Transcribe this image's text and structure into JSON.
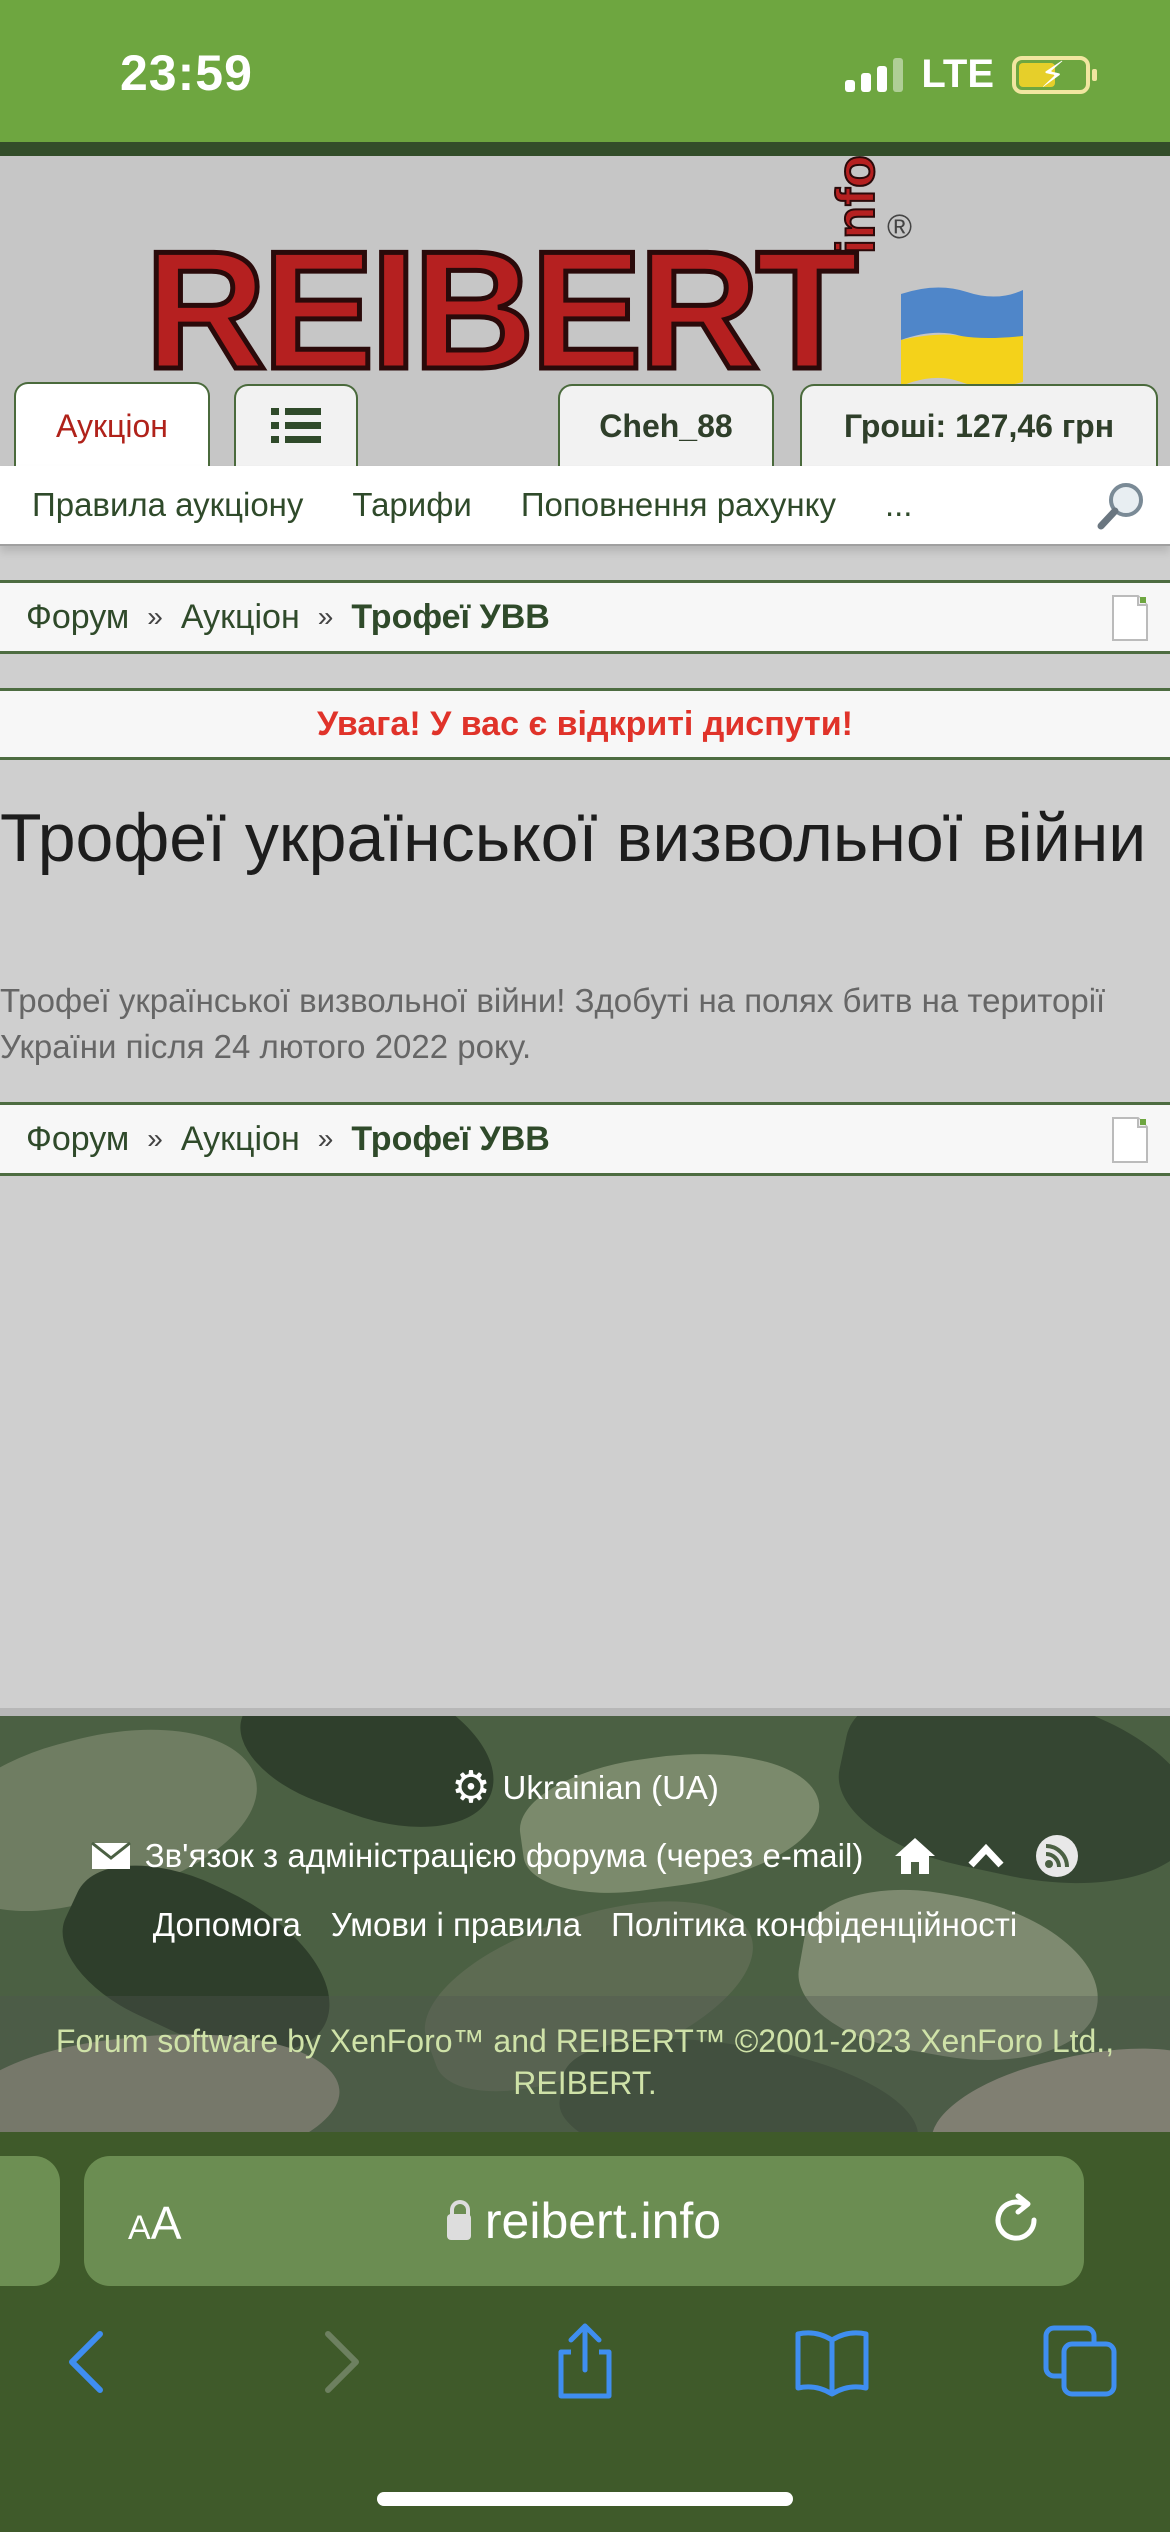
{
  "status": {
    "time": "23:59",
    "network": "LTE"
  },
  "logo": {
    "main": "REIBERT",
    "sub": "info",
    "reg": "®"
  },
  "tabs": {
    "auction": "Аукціон",
    "user": "Cheh_88",
    "money": "Гроші: 127,46 грн"
  },
  "nav": {
    "items": [
      "Правила аукціону",
      "Тарифи",
      "Поповнення рахунку",
      "..."
    ]
  },
  "breadcrumb": {
    "forum": "Форум",
    "auction": "Аукціон",
    "current": "Трофеї УВВ",
    "sep": "»"
  },
  "alert": "Увага! У вас є відкриті диспути!",
  "page": {
    "title": "Трофеї української визвольної війни",
    "description": "Трофеї української визвольної війни! Здобуті на полях битв на території України після 24 лютого 2022 року."
  },
  "footer": {
    "language": "Ukrainian (UA)",
    "contact": "Зв'язок з адміністрацією форума (через e-mail)",
    "links": [
      "Допомога",
      "Умови і правила",
      "Політика конфіденційності"
    ],
    "copyright": "Forum software by XenForo™ and REIBERT™ ©2001-2023 XenForo Ltd., REIBERT."
  },
  "safari": {
    "aa": "AA",
    "url": "reibert.info"
  },
  "colors": {
    "brand_green": "#6ea640",
    "dark_green": "#334d2a",
    "alert_red": "#e0332a",
    "logo_red": "#b52020"
  }
}
